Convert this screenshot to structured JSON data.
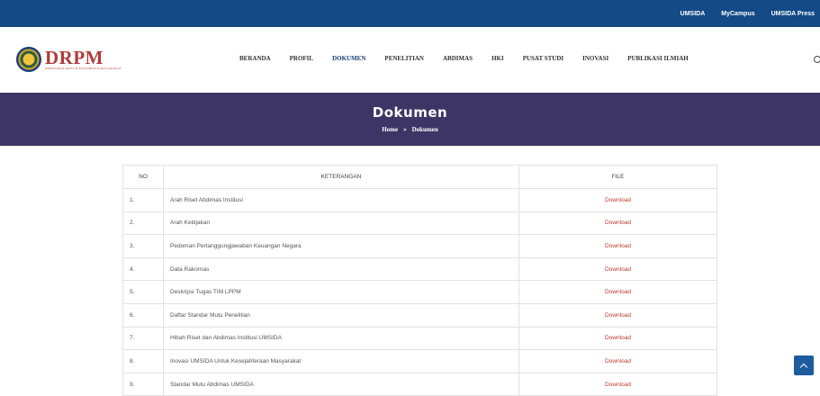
{
  "topbar": {
    "links": [
      "UMSIDA",
      "MyCampus",
      "UMSIDA Press"
    ]
  },
  "logo": {
    "title": "DRPM",
    "subtitle": "DIREKTORAT RISET & PENGABDIAN MASYARAKAT"
  },
  "nav": {
    "items": [
      "BERANDA",
      "PROFIL",
      "DOKUMEN",
      "PENELITIAN",
      "ABDIMAS",
      "HKI",
      "PUSAT STUDI",
      "INOVASI",
      "PUBLIKASI ILMIAH"
    ],
    "active": "DOKUMEN"
  },
  "banner": {
    "title": "Dokumen",
    "breadcrumb_home": "Home",
    "breadcrumb_sep": "»",
    "breadcrumb_current": "Dokumen"
  },
  "table": {
    "headers": [
      "NO",
      "KETERANGAN",
      "FILE"
    ],
    "rows": [
      {
        "no": "1.",
        "keterangan": "Arah Riset Abdimas Institusi",
        "file": "Download"
      },
      {
        "no": "2.",
        "keterangan": "Arah Kebijakan",
        "file": "Download"
      },
      {
        "no": "3.",
        "keterangan": "Pedoman Pertanggungjawaban Keuangan Negara",
        "file": "Download"
      },
      {
        "no": "4.",
        "keterangan": "Data Rakornas",
        "file": "Download"
      },
      {
        "no": "5.",
        "keterangan": "Deskripsi Tugas TIM LPPM",
        "file": "Download"
      },
      {
        "no": "6.",
        "keterangan": "Daftar Standar Mutu Penelitian",
        "file": "Download"
      },
      {
        "no": "7.",
        "keterangan": "Hibah Riset dan Abdimas Institusi UMSIDA",
        "file": "Download"
      },
      {
        "no": "8.",
        "keterangan": "Inovasi UMSIDA Untuk Kesejahteraan Masyarakat",
        "file": "Download"
      },
      {
        "no": "9.",
        "keterangan": "Standar Mutu Abdimas UMSIDA",
        "file": "Download"
      }
    ]
  },
  "colors": {
    "topbar": "#144a86",
    "banner": "#3d3565",
    "download_link": "#c0392b",
    "nav_active": "#1b3f7a"
  },
  "icons": {
    "search": "search-icon",
    "scroll_top": "chevron-up-icon"
  }
}
